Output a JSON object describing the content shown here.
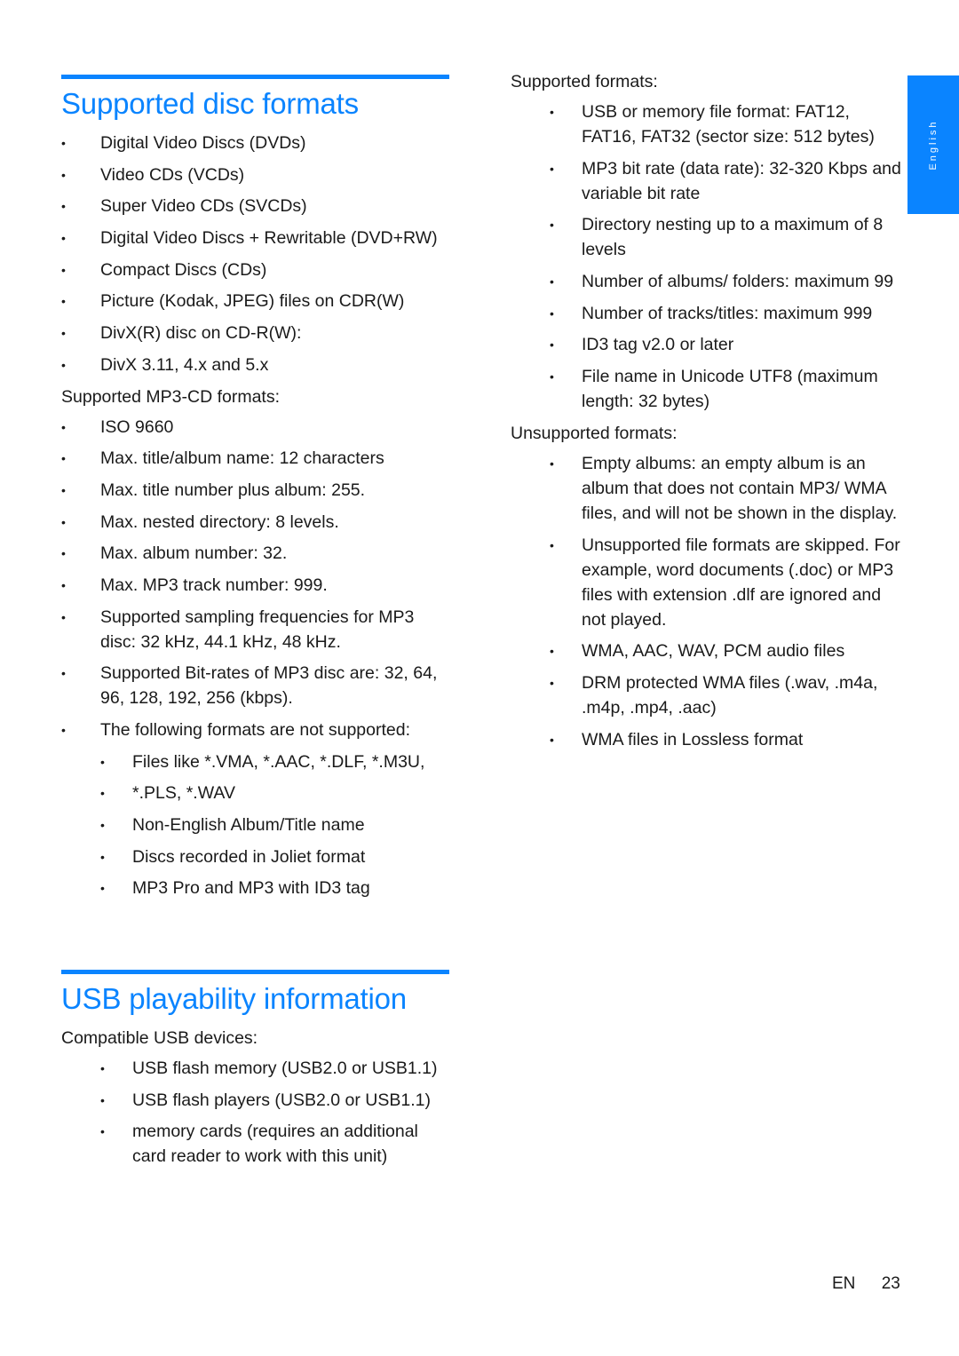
{
  "language_tab": "English",
  "footer": {
    "lang": "EN",
    "page_number": "23"
  },
  "disc_formats": {
    "title": "Supported disc formats",
    "items": [
      "Digital Video Discs (DVDs)",
      "Video CDs (VCDs)",
      "Super Video CDs (SVCDs)",
      "Digital Video Discs + Rewritable (DVD+RW)",
      "Compact Discs (CDs)",
      "Picture (Kodak, JPEG) files on CDR(W)",
      "DivX(R) disc on CD-R(W):",
      "DivX 3.11, 4.x and 5.x"
    ],
    "mp3cd_heading": "Supported MP3-CD formats:",
    "mp3cd_items": [
      "ISO 9660",
      "Max. title/album name: 12 characters",
      "Max. title number plus album: 255.",
      "Max. nested directory: 8 levels.",
      "Max. album number: 32.",
      "Max. MP3 track number: 999.",
      "Supported sampling frequencies for MP3 disc: 32 kHz, 44.1 kHz, 48 kHz.",
      "Supported Bit-rates of MP3 disc are: 32, 64, 96, 128, 192, 256 (kbps).",
      "The following formats are not supported:"
    ],
    "not_supported_items": [
      "Files like *.VMA, *.AAC, *.DLF, *.M3U,",
      "*.PLS, *.WAV",
      "Non-English Album/Title name",
      "Discs recorded in Joliet format",
      "MP3 Pro and MP3 with ID3 tag"
    ]
  },
  "usb": {
    "title": "USB playability information",
    "compatible_heading": "Compatible USB devices:",
    "compatible_items": [
      "USB flash memory (USB2.0 or USB1.1)",
      "USB flash players (USB2.0 or USB1.1)",
      "memory cards (requires an additional card reader to work with this unit)"
    ],
    "supported_heading": "Supported formats:",
    "supported_items": [
      "USB or memory file format: FAT12, FAT16, FAT32 (sector size: 512 bytes)",
      "MP3 bit rate (data rate): 32-320 Kbps and variable bit rate",
      "Directory nesting up to a maximum of 8 levels",
      "Number of albums/ folders: maximum 99",
      "Number of tracks/titles: maximum 999",
      "ID3 tag v2.0 or later",
      "File name in Unicode UTF8 (maximum length: 32 bytes)"
    ],
    "unsupported_heading": "Unsupported formats:",
    "unsupported_items": [
      "Empty albums: an empty album is an album that does not contain MP3/ WMA files, and will not be shown in the display.",
      "Unsupported file formats are skipped. For example, word documents (.doc) or MP3 files with extension .dlf are ignored and not played.",
      "WMA, AAC, WAV, PCM audio files",
      "DRM protected WMA files (.wav, .m4a, .m4p, .mp4, .aac)",
      "WMA files in Lossless format"
    ]
  },
  "bullet_glyph": "•",
  "colors": {
    "accent": "#0a84ff",
    "text": "#1a1a1a"
  }
}
